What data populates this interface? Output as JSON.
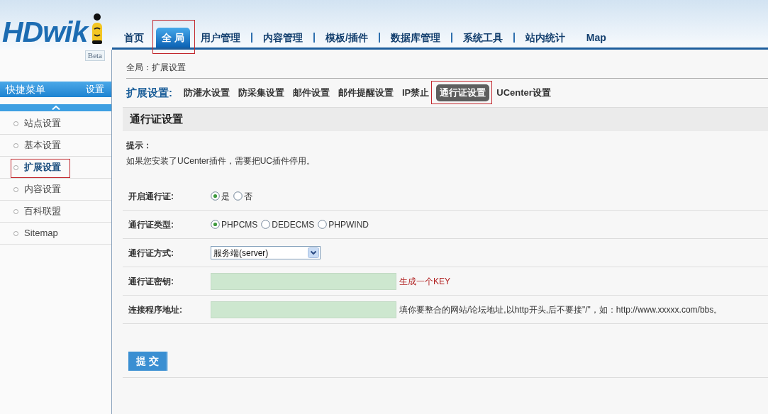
{
  "logo": {
    "text": "HDwik",
    "badge": "Beta"
  },
  "nav": {
    "items": [
      {
        "label": "首页",
        "selected": false,
        "highlighted": false,
        "divider_before": false
      },
      {
        "label": "全 局",
        "selected": true,
        "highlighted": true,
        "divider_before": false
      },
      {
        "label": "用户管理",
        "selected": false,
        "highlighted": false,
        "divider_before": false
      },
      {
        "label": "内容管理",
        "selected": false,
        "highlighted": false,
        "divider_before": true
      },
      {
        "label": "模板/插件",
        "selected": false,
        "highlighted": false,
        "divider_before": true
      },
      {
        "label": "数据库管理",
        "selected": false,
        "highlighted": false,
        "divider_before": true
      },
      {
        "label": "系统工具",
        "selected": false,
        "highlighted": false,
        "divider_before": true
      },
      {
        "label": "站内统计",
        "selected": false,
        "highlighted": false,
        "divider_before": true
      },
      {
        "label": "Map",
        "selected": false,
        "highlighted": false,
        "divider_before": false
      }
    ]
  },
  "sidebar": {
    "title": "快捷菜单",
    "action": "设置",
    "items": [
      {
        "label": "站点设置",
        "selected": false,
        "highlighted": false
      },
      {
        "label": "基本设置",
        "selected": false,
        "highlighted": false
      },
      {
        "label": "扩展设置",
        "selected": true,
        "highlighted": true
      },
      {
        "label": "内容设置",
        "selected": false,
        "highlighted": false
      },
      {
        "label": "百科联盟",
        "selected": false,
        "highlighted": false
      },
      {
        "label": "Sitemap",
        "selected": false,
        "highlighted": false
      }
    ]
  },
  "breadcrumb": "全局：扩展设置",
  "subnav": {
    "title": "扩展设置:",
    "items": [
      {
        "label": "防灌水设置",
        "selected": false,
        "highlighted": false
      },
      {
        "label": "防采集设置",
        "selected": false,
        "highlighted": false
      },
      {
        "label": "邮件设置",
        "selected": false,
        "highlighted": false
      },
      {
        "label": "邮件提醒设置",
        "selected": false,
        "highlighted": false
      },
      {
        "label": "IP禁止",
        "selected": false,
        "highlighted": false
      },
      {
        "label": "通行证设置",
        "selected": true,
        "highlighted": true
      },
      {
        "label": "UCenter设置",
        "selected": false,
        "highlighted": false
      }
    ]
  },
  "section": {
    "title": "通行证设置",
    "tip_title": "提示：",
    "tip_text": "如果您安装了UCenter插件，需要把UC插件停用。"
  },
  "form": {
    "rows": [
      {
        "kind": "radio",
        "label": "开启通行证:",
        "options": [
          {
            "label": "是",
            "selected": true
          },
          {
            "label": "否",
            "selected": false
          }
        ]
      },
      {
        "kind": "radio",
        "label": "通行证类型:",
        "options": [
          {
            "label": "PHPCMS",
            "selected": true
          },
          {
            "label": "DEDECMS",
            "selected": false
          },
          {
            "label": "PHPWIND",
            "selected": false
          }
        ]
      },
      {
        "kind": "select",
        "label": "通行证方式:",
        "value": "服务端(server)"
      },
      {
        "kind": "text",
        "label": "通行证密钥:",
        "link": "生成一个KEY"
      },
      {
        "kind": "text",
        "label": "连接程序地址:",
        "hint": "填你要整合的网站/论坛地址,以http开头,后不要接\"/\"，如：http://www.xxxxx.com/bbs。"
      }
    ]
  },
  "submit": "提 交"
}
